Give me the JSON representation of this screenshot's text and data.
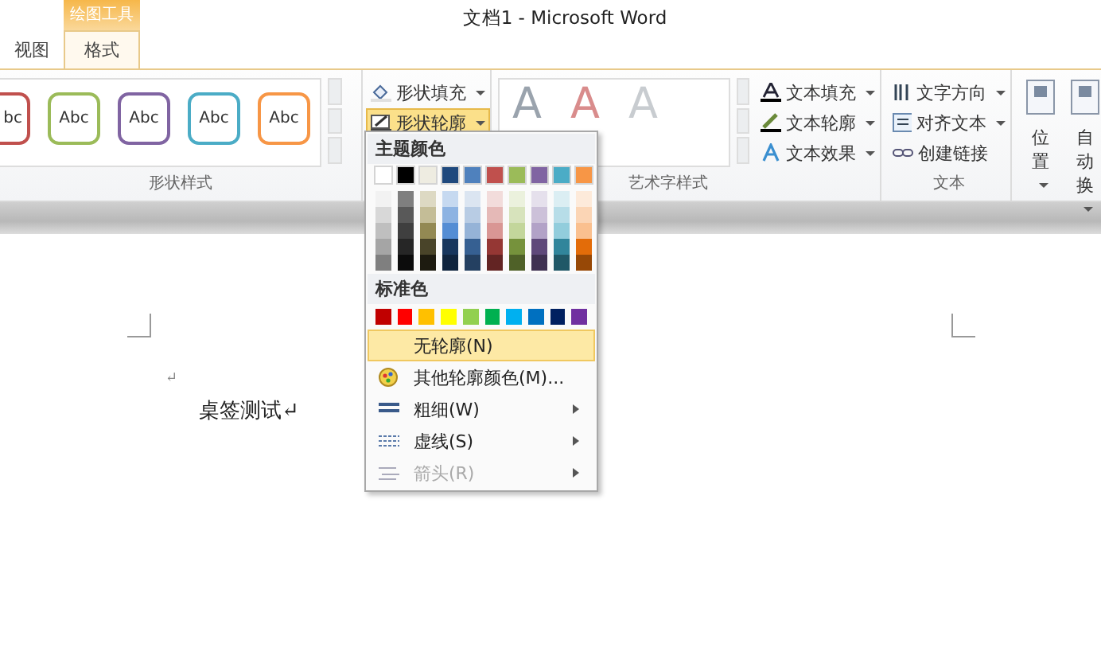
{
  "window": {
    "title": "文档1 - Microsoft Word",
    "context_label": "绘图工具"
  },
  "tabs": [
    {
      "label": "视图",
      "selected": false
    },
    {
      "label": "格式",
      "selected": true
    }
  ],
  "ribbon": {
    "shape_styles": {
      "label": "形状样式",
      "presets": [
        {
          "text": "bc",
          "color": "#c0504d"
        },
        {
          "text": "Abc",
          "color": "#9bbb59"
        },
        {
          "text": "Abc",
          "color": "#8064a2"
        },
        {
          "text": "Abc",
          "color": "#4bacc6"
        },
        {
          "text": "Abc",
          "color": "#f79646"
        }
      ]
    },
    "shape_commands": [
      {
        "label": "形状填充",
        "kind": "fill",
        "selected": false
      },
      {
        "label": "形状轮廓",
        "kind": "outline",
        "selected": true
      }
    ],
    "wordart": {
      "label": "艺术字样式",
      "presets": [
        {
          "text": "A",
          "color": "#9aa3ad"
        },
        {
          "text": "A",
          "color": "#d98c8c"
        },
        {
          "text": "A",
          "color": "#c8ccd0"
        }
      ],
      "commands": [
        {
          "label": "文本填充",
          "kind": "text-fill"
        },
        {
          "label": "文本轮廓",
          "kind": "text-outline"
        },
        {
          "label": "文本效果",
          "kind": "text-effect"
        }
      ]
    },
    "text_group": {
      "label": "文本",
      "commands": [
        {
          "label": "文字方向",
          "kind": "direction",
          "dropdown": true
        },
        {
          "label": "对齐文本",
          "kind": "align",
          "dropdown": true
        },
        {
          "label": "创建链接",
          "kind": "link",
          "dropdown": false
        }
      ]
    },
    "arrange": [
      {
        "label": "位置"
      },
      {
        "label": "自动换"
      }
    ]
  },
  "document": {
    "paragraphs": [
      {
        "text": "↵"
      },
      {
        "text": "桌签测试↵"
      }
    ]
  },
  "outline_menu": {
    "theme_heading": "主题颜色",
    "theme_colors": [
      {
        "color": "#ffffff",
        "shades": [
          {
            "color": "#f2f2f2"
          },
          {
            "color": "#d8d8d8"
          },
          {
            "color": "#bfbfbf"
          },
          {
            "color": "#a5a5a5"
          },
          {
            "color": "#7f7f7f"
          }
        ]
      },
      {
        "color": "#000000",
        "shades": [
          {
            "color": "#7f7f7f"
          },
          {
            "color": "#595959"
          },
          {
            "color": "#3f3f3f"
          },
          {
            "color": "#262626"
          },
          {
            "color": "#0c0c0c"
          }
        ]
      },
      {
        "color": "#eeece1",
        "shades": [
          {
            "color": "#ddd9c3"
          },
          {
            "color": "#c4bd97"
          },
          {
            "color": "#938953"
          },
          {
            "color": "#494429"
          },
          {
            "color": "#1d1b10"
          }
        ]
      },
      {
        "color": "#1f497d",
        "shades": [
          {
            "color": "#c6d9f0"
          },
          {
            "color": "#8db3e2"
          },
          {
            "color": "#548dd4"
          },
          {
            "color": "#17365d"
          },
          {
            "color": "#0f243e"
          }
        ]
      },
      {
        "color": "#4f81bd",
        "shades": [
          {
            "color": "#dbe5f1"
          },
          {
            "color": "#b8cce4"
          },
          {
            "color": "#95b3d7"
          },
          {
            "color": "#366092"
          },
          {
            "color": "#244061"
          }
        ]
      },
      {
        "color": "#c0504d",
        "shades": [
          {
            "color": "#f2dcdb"
          },
          {
            "color": "#e5b9b7"
          },
          {
            "color": "#d99694"
          },
          {
            "color": "#953734"
          },
          {
            "color": "#632423"
          }
        ]
      },
      {
        "color": "#9bbb59",
        "shades": [
          {
            "color": "#ebf1dd"
          },
          {
            "color": "#d7e3bc"
          },
          {
            "color": "#c3d69b"
          },
          {
            "color": "#76923c"
          },
          {
            "color": "#4f6128"
          }
        ]
      },
      {
        "color": "#8064a2",
        "shades": [
          {
            "color": "#e5e0ec"
          },
          {
            "color": "#ccc1d9"
          },
          {
            "color": "#b2a2c7"
          },
          {
            "color": "#5f497a"
          },
          {
            "color": "#3f3151"
          }
        ]
      },
      {
        "color": "#4bacc6",
        "shades": [
          {
            "color": "#dbeef3"
          },
          {
            "color": "#b7dde8"
          },
          {
            "color": "#92cddc"
          },
          {
            "color": "#31859b"
          },
          {
            "color": "#205867"
          }
        ]
      },
      {
        "color": "#f79646",
        "shades": [
          {
            "color": "#fdeada"
          },
          {
            "color": "#fbd5b5"
          },
          {
            "color": "#fac08f"
          },
          {
            "color": "#e36c09"
          },
          {
            "color": "#974806"
          }
        ]
      }
    ],
    "standard_heading": "标准色",
    "standard_colors": [
      {
        "color": "#c00000"
      },
      {
        "color": "#ff0000"
      },
      {
        "color": "#ffc000"
      },
      {
        "color": "#ffff00"
      },
      {
        "color": "#92d050"
      },
      {
        "color": "#00b050"
      },
      {
        "color": "#00b0f0"
      },
      {
        "color": "#0070c0"
      },
      {
        "color": "#002060"
      },
      {
        "color": "#7030a0"
      }
    ],
    "items": [
      {
        "label": "无轮廓(N)",
        "kind": "none",
        "selected": true,
        "disabled": false,
        "submenu": false
      },
      {
        "label": "其他轮廓颜色(M)...",
        "kind": "more-colors",
        "selected": false,
        "disabled": false,
        "submenu": false
      },
      {
        "label": "粗细(W)",
        "kind": "weight",
        "selected": false,
        "disabled": false,
        "submenu": true
      },
      {
        "label": "虚线(S)",
        "kind": "dashes",
        "selected": false,
        "disabled": false,
        "submenu": true
      },
      {
        "label": "箭头(R)",
        "kind": "arrows",
        "selected": false,
        "disabled": true,
        "submenu": true
      }
    ]
  }
}
